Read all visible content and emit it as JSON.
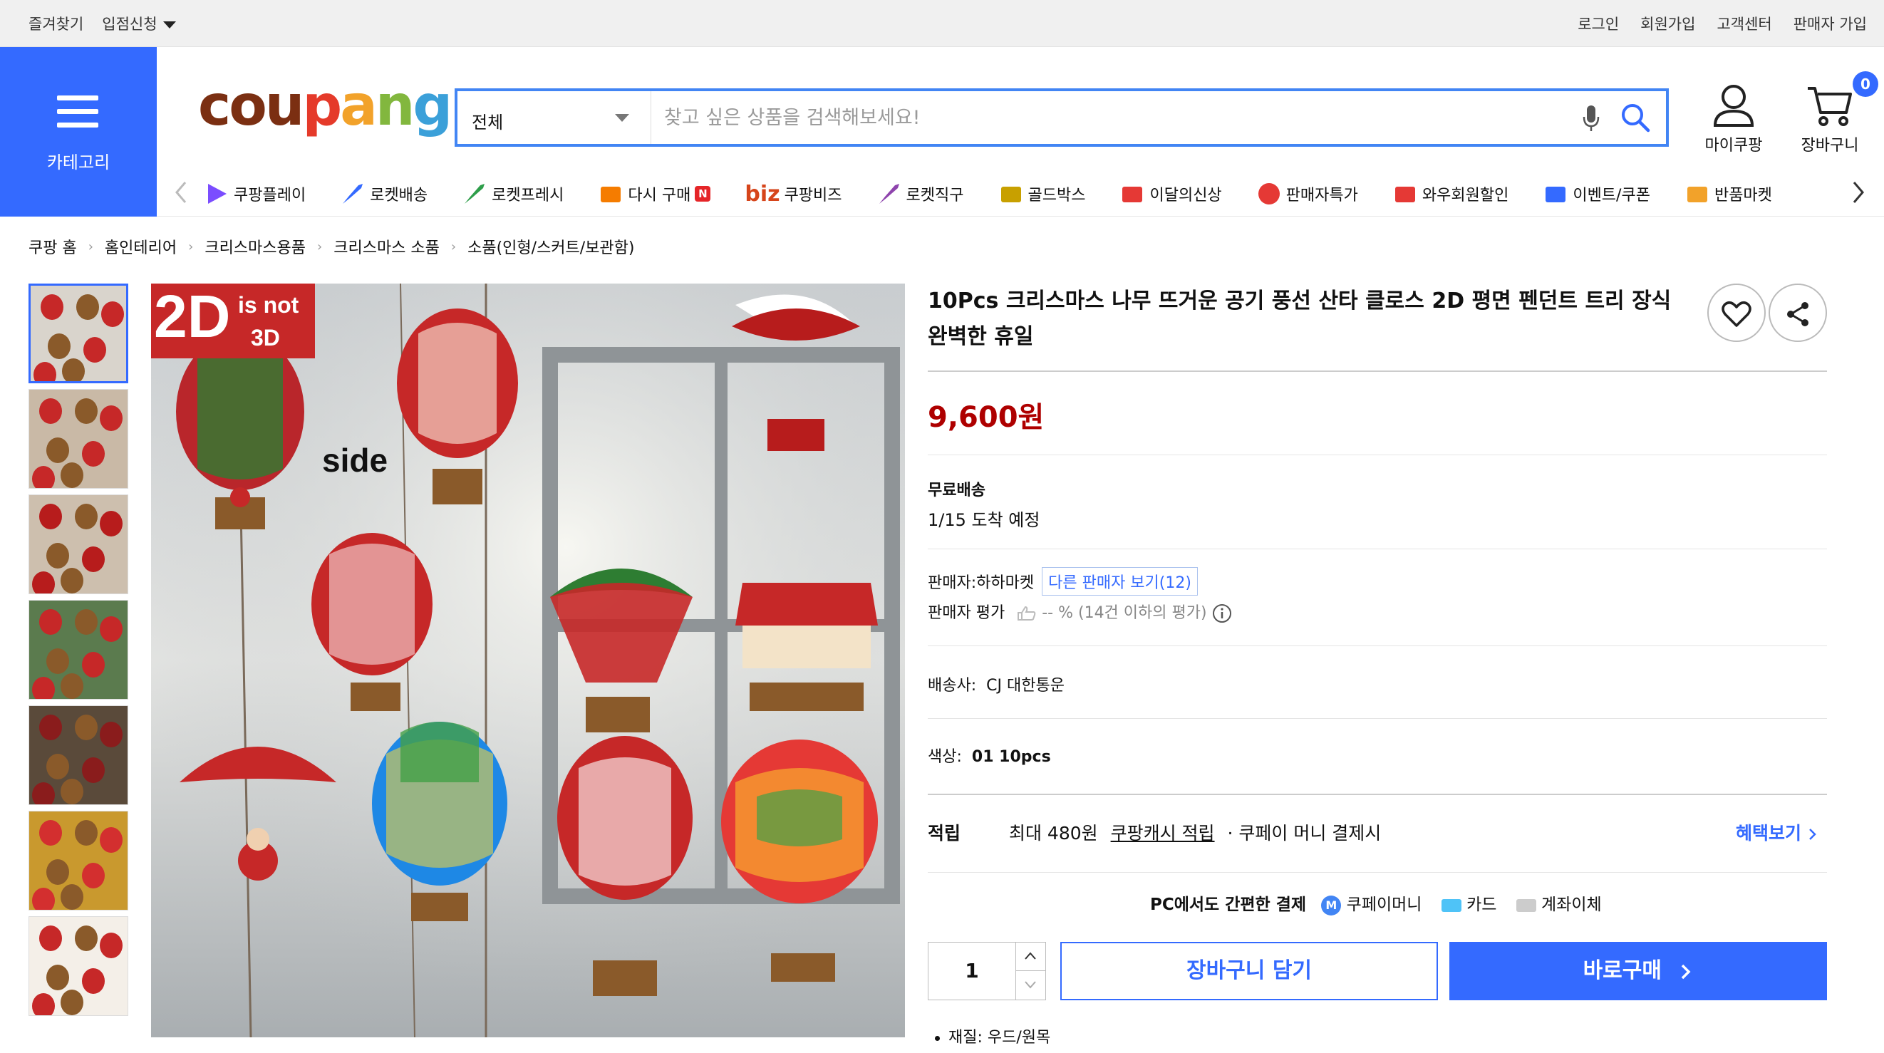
{
  "topbar": {
    "left": [
      "즐겨찾기",
      "입점신청"
    ],
    "right": [
      "로그인",
      "회원가입",
      "고객센터",
      "판매자 가입"
    ]
  },
  "category_button": {
    "label": "카테고리"
  },
  "logo": {
    "letters": [
      "c",
      "o",
      "u",
      "p",
      "a",
      "n",
      "g"
    ],
    "colors": [
      "#7b2f12",
      "#7b2f12",
      "#7b2f12",
      "#e53a2a",
      "#f2a22a",
      "#82b73e",
      "#3ba0d9"
    ]
  },
  "search": {
    "category": "전체",
    "placeholder": "찾고 싶은 상품을 검색해보세요!"
  },
  "account": {
    "label": "마이쿠팡"
  },
  "cart": {
    "label": "장바구니",
    "count": "0"
  },
  "nav": {
    "items": [
      {
        "label": "쿠팡플레이",
        "icon": "coupang-play-icon"
      },
      {
        "label": "로켓배송",
        "icon": "rocket-delivery-icon"
      },
      {
        "label": "로켓프레시",
        "icon": "rocket-fresh-icon"
      },
      {
        "label": "다시 구매",
        "icon": "rebuy-icon",
        "badge": "N"
      },
      {
        "label": "쿠팡비즈",
        "prefix": "biz",
        "icon": "biz-icon"
      },
      {
        "label": "로켓직구",
        "icon": "rocket-global-icon"
      },
      {
        "label": "골드박스",
        "icon": "goldbox-icon"
      },
      {
        "label": "이달의신상",
        "icon": "new-arrival-icon"
      },
      {
        "label": "판매자특가",
        "icon": "seller-deal-icon"
      },
      {
        "label": "와우회원할인",
        "icon": "wow-icon"
      },
      {
        "label": "이벤트/쿠폰",
        "icon": "coupon-icon"
      },
      {
        "label": "반품마켓",
        "icon": "return-market-icon"
      }
    ]
  },
  "breadcrumb": [
    "쿠팡 홈",
    "홈인테리어",
    "크리스마스용품",
    "크리스마스 소품",
    "소품(인형/스커트/보관함)"
  ],
  "product": {
    "title": "10Pcs 크리스마스 나무 뜨거운 공기 풍선 산타 클로스 2D 평면 펜던트 트리 장식 완벽한 휴일",
    "price": "9,600원",
    "image_caption_big": "2D",
    "image_caption_small1": "is not",
    "image_caption_small2": "3D",
    "image_side": "side",
    "shipping_label": "무료배송",
    "arrival": "1/15 도착 예정",
    "seller_prefix": "판매자:",
    "seller_name": "하하마켓",
    "other_sellers": "다른 판매자 보기(12)",
    "seller_rating_label": "판매자 평가",
    "seller_rating_value": "-- %",
    "seller_rating_note": "(14건 이하의 평가)",
    "courier_label": "배송사:",
    "courier": "CJ 대한통운",
    "color_label": "색상:",
    "color": "01 10pcs",
    "points_label": "적립",
    "points_max": "최대 480원",
    "points_link": "쿠팡캐시 적립",
    "points_tail": "· 쿠페이 머니 결제시",
    "benefits_link": "혜택보기",
    "payment_label": "PC에서도 간편한 결제",
    "payment_methods": [
      "쿠페이머니",
      "카드",
      "계좌이체"
    ],
    "quantity": "1",
    "add_to_cart": "장바구니 담기",
    "buy_now": "바로구매",
    "material": "재질: 우드/원목"
  }
}
